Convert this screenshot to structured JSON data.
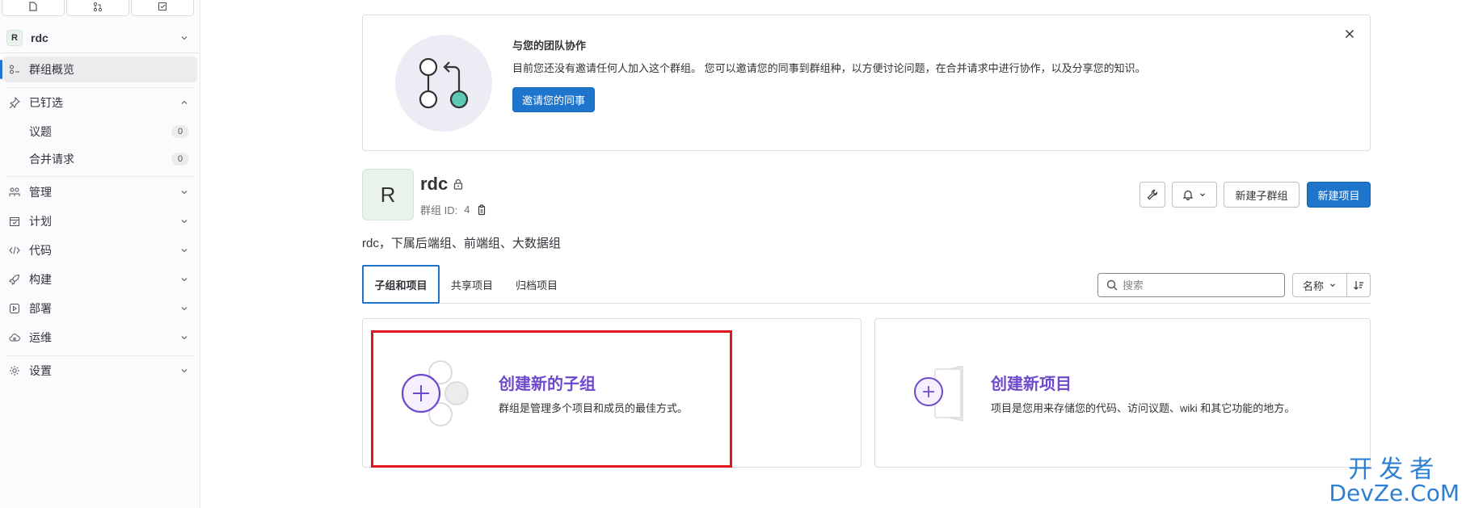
{
  "sidebar": {
    "context": {
      "avatar_letter": "R",
      "name": "rdc"
    },
    "overview": "群组概览",
    "pinned": {
      "label": "已钉选",
      "items": [
        {
          "label": "议题",
          "count": "0"
        },
        {
          "label": "合并请求",
          "count": "0"
        }
      ]
    },
    "sections": [
      "管理",
      "计划",
      "代码",
      "构建",
      "部署",
      "运维",
      "设置"
    ]
  },
  "banner": {
    "title": "与您的团队协作",
    "text": "目前您还没有邀请任何人加入这个群组。 您可以邀请您的同事到群组种，以方便讨论问题，在合并请求中进行协作，以及分享您的知识。",
    "button": "邀请您的同事"
  },
  "group": {
    "avatar_letter": "R",
    "name": "rdc",
    "id_label": "群组 ID:",
    "id_value": "4",
    "description": "rdc，下属后端组、前端组、大数据组"
  },
  "actions": {
    "new_subgroup": "新建子群组",
    "new_project": "新建项目"
  },
  "tabs": [
    "子组和项目",
    "共享项目",
    "归档项目"
  ],
  "search": {
    "placeholder": "搜索"
  },
  "sort": {
    "selected": "名称"
  },
  "cards": {
    "subgroup": {
      "title": "创建新的子组",
      "text": "群组是管理多个项目和成员的最佳方式。"
    },
    "project": {
      "title": "创建新项目",
      "text": "项目是您用来存储您的代码、访问议题、wiki 和其它功能的地方。"
    }
  },
  "watermark": {
    "cn": "开发者",
    "en": "DevZe.CoM"
  },
  "colors": {
    "primary": "#1f75cb",
    "purple": "#6e49cb",
    "highlight": "#e0181e"
  }
}
